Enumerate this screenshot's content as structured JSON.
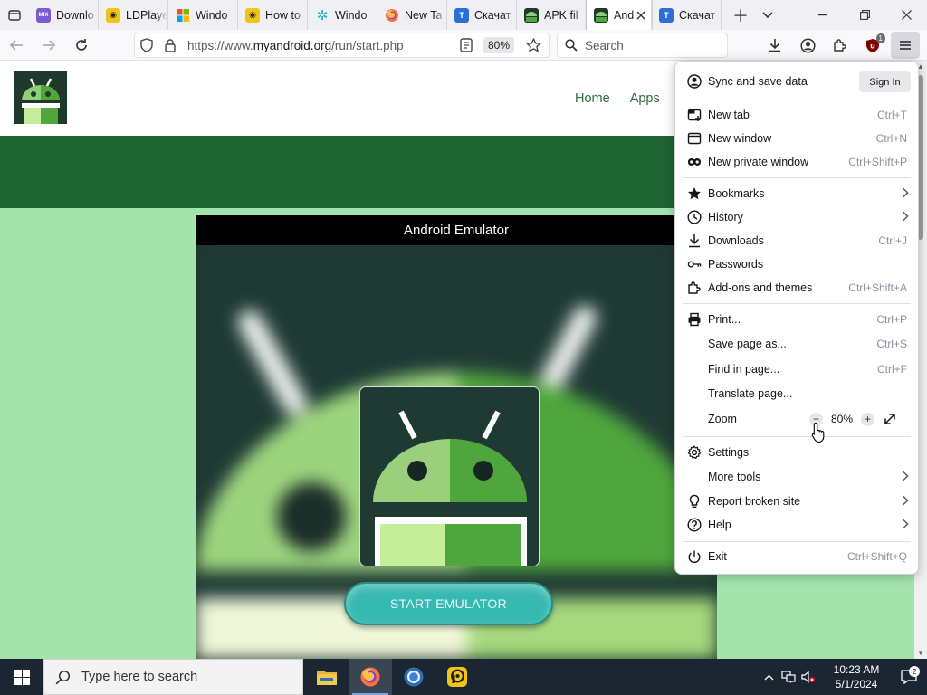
{
  "tabs": [
    {
      "label": "Downlo",
      "favicon": "mix-icon",
      "color": "#7b5ccf",
      "active": false
    },
    {
      "label": "LDPlayer",
      "favicon": "ldplayer-icon",
      "color": "#f0c419",
      "active": false
    },
    {
      "label": "Windo",
      "favicon": "windows-icon",
      "color": "#f25022",
      "active": false
    },
    {
      "label": "How to",
      "favicon": "ldplayer-icon",
      "color": "#f0c419",
      "active": false
    },
    {
      "label": "Windo",
      "favicon": "pinwheel-icon",
      "color": "#16b8c8",
      "active": false
    },
    {
      "label": "New Ta",
      "favicon": "firefox-icon",
      "color": "#ff7139",
      "active": false
    },
    {
      "label": "Скачат",
      "favicon": "t-icon",
      "color": "#2b6fd6",
      "active": false
    },
    {
      "label": "APK fil",
      "favicon": "android-icon",
      "color": "#2e8b3a",
      "active": false
    },
    {
      "label": "And",
      "favicon": "android-icon",
      "color": "#2e8b3a",
      "active": true
    },
    {
      "label": "Скачат",
      "favicon": "t-icon",
      "color": "#2b6fd6",
      "active": false
    }
  ],
  "nav": {
    "url_prefix": "https://www.",
    "url_host": "myandroid.org",
    "url_path": "/run/start.php",
    "zoom": "80%",
    "search_placeholder": "Search",
    "extension_badge": "1"
  },
  "site": {
    "nav_items": [
      "Home",
      "Apps"
    ],
    "emulator_title": "Android Emulator",
    "start_button": "START EMULATOR"
  },
  "menu": {
    "sync_label": "Sync and save data",
    "sign_in": "Sign In",
    "new_tab": {
      "label": "New tab",
      "shortcut": "Ctrl+T"
    },
    "new_window": {
      "label": "New window",
      "shortcut": "Ctrl+N"
    },
    "private_window": {
      "label": "New private window",
      "shortcut": "Ctrl+Shift+P"
    },
    "bookmarks": {
      "label": "Bookmarks"
    },
    "history": {
      "label": "History"
    },
    "downloads": {
      "label": "Downloads",
      "shortcut": "Ctrl+J"
    },
    "passwords": {
      "label": "Passwords"
    },
    "addons": {
      "label": "Add-ons and themes",
      "shortcut": "Ctrl+Shift+A"
    },
    "print": {
      "label": "Print...",
      "shortcut": "Ctrl+P"
    },
    "save_page": {
      "label": "Save page as...",
      "shortcut": "Ctrl+S"
    },
    "find": {
      "label": "Find in page...",
      "shortcut": "Ctrl+F"
    },
    "translate": {
      "label": "Translate page..."
    },
    "zoom": {
      "label": "Zoom",
      "value": "80%"
    },
    "settings": {
      "label": "Settings"
    },
    "more_tools": {
      "label": "More tools"
    },
    "report": {
      "label": "Report broken site"
    },
    "help": {
      "label": "Help"
    },
    "exit": {
      "label": "Exit",
      "shortcut": "Ctrl+Shift+Q"
    }
  },
  "taskbar": {
    "search_placeholder": "Type here to search",
    "time": "10:23 AM",
    "date": "5/1/2024",
    "notification_count": "2"
  },
  "colors": {
    "site_green": "#1f6433",
    "site_light_green": "#a3e4ad",
    "button_teal": "#36b9b0"
  }
}
